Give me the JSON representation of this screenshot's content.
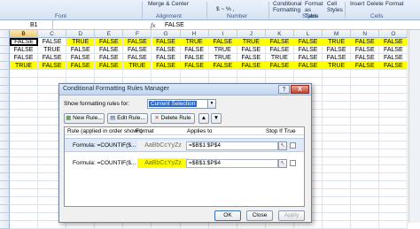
{
  "ribbon": {
    "font_group": "Font",
    "alignment_group": "Alignment",
    "merge_center": "Merge & Center",
    "number_group": "Number",
    "currency_format": "$ ~ % ,",
    "cond_formatting": "Conditional Formatting",
    "format_as_table": "Format as Table",
    "cell_styles": "Cell Styles",
    "styles_group": "Styles",
    "insert": "Insert",
    "delete": "Delete",
    "format": "Format",
    "cells_group": "Cells"
  },
  "formula_bar": {
    "name_box": "B1",
    "fx": "fx",
    "value": "FALSE"
  },
  "sheet": {
    "columns": [
      "B",
      "C",
      "D",
      "E",
      "F",
      "G",
      "H",
      "I",
      "J",
      "K",
      "L",
      "M",
      "N",
      "O"
    ],
    "selected_column": "B",
    "rows": [
      {
        "cells": [
          "FALSE",
          "FALSE",
          "TRUE",
          "FALSE",
          "FALSE",
          "FALSE",
          "TRUE",
          "FALSE",
          "TRUE",
          "FALSE",
          "FALSE",
          "TRUE",
          "FALSE",
          "FALSE"
        ],
        "yellow": [
          false,
          false,
          true,
          true,
          true,
          true,
          true,
          true,
          true,
          true,
          true,
          true,
          true,
          true
        ]
      },
      {
        "cells": [
          "FALSE",
          "TRUE",
          "FALSE",
          "FALSE",
          "FALSE",
          "FALSE",
          "FALSE",
          "TRUE",
          "FALSE",
          "FALSE",
          "FALSE",
          "FALSE",
          "FALSE",
          "FALSE"
        ],
        "yellow": [
          false,
          false,
          false,
          false,
          false,
          false,
          false,
          false,
          false,
          false,
          false,
          false,
          false,
          false
        ]
      },
      {
        "cells": [
          "FALSE",
          "FALSE",
          "FALSE",
          "FALSE",
          "FALSE",
          "FALSE",
          "FALSE",
          "TRUE",
          "FALSE",
          "TRUE",
          "FALSE",
          "FALSE",
          "FALSE",
          "FALSE"
        ],
        "yellow": [
          false,
          false,
          false,
          false,
          false,
          false,
          false,
          false,
          false,
          false,
          false,
          false,
          false,
          false
        ]
      },
      {
        "cells": [
          "TRUE",
          "FALSE",
          "FALSE",
          "FALSE",
          "TRUE",
          "FALSE",
          "FALSE",
          "FALSE",
          "FALSE",
          "FALSE",
          "FALSE",
          "TRUE",
          "FALSE",
          "FALSE"
        ],
        "yellow": [
          true,
          true,
          true,
          true,
          true,
          true,
          true,
          true,
          true,
          true,
          true,
          true,
          true,
          true
        ]
      }
    ]
  },
  "dialog": {
    "title": "Conditional Formatting Rules Manager",
    "help": "?",
    "close": "X",
    "show_rules_label": "Show formatting rules for:",
    "show_rules_value": "Current Selection",
    "new_rule": "New Rule...",
    "edit_rule": "Edit Rule...",
    "delete_rule": "Delete Rule",
    "headers": {
      "rule": "Rule (applied in order shown)",
      "format": "Format",
      "applies_to": "Applies to",
      "stop_if_true": "Stop If True"
    },
    "rules": [
      {
        "rule": "Formula: =COUNTIF($...",
        "format_preview": "AaBbCcYyZz",
        "format_color": "#f0f0f0",
        "applies_to": "=$B$1:$P$4"
      },
      {
        "rule": "Formula: =COUNTIF($...",
        "format_preview": "AaBbCcYyZz",
        "format_color": "#ffff00",
        "applies_to": "=$B$1:$P$4"
      }
    ],
    "ok": "OK",
    "close_btn": "Close",
    "apply": "Apply"
  }
}
